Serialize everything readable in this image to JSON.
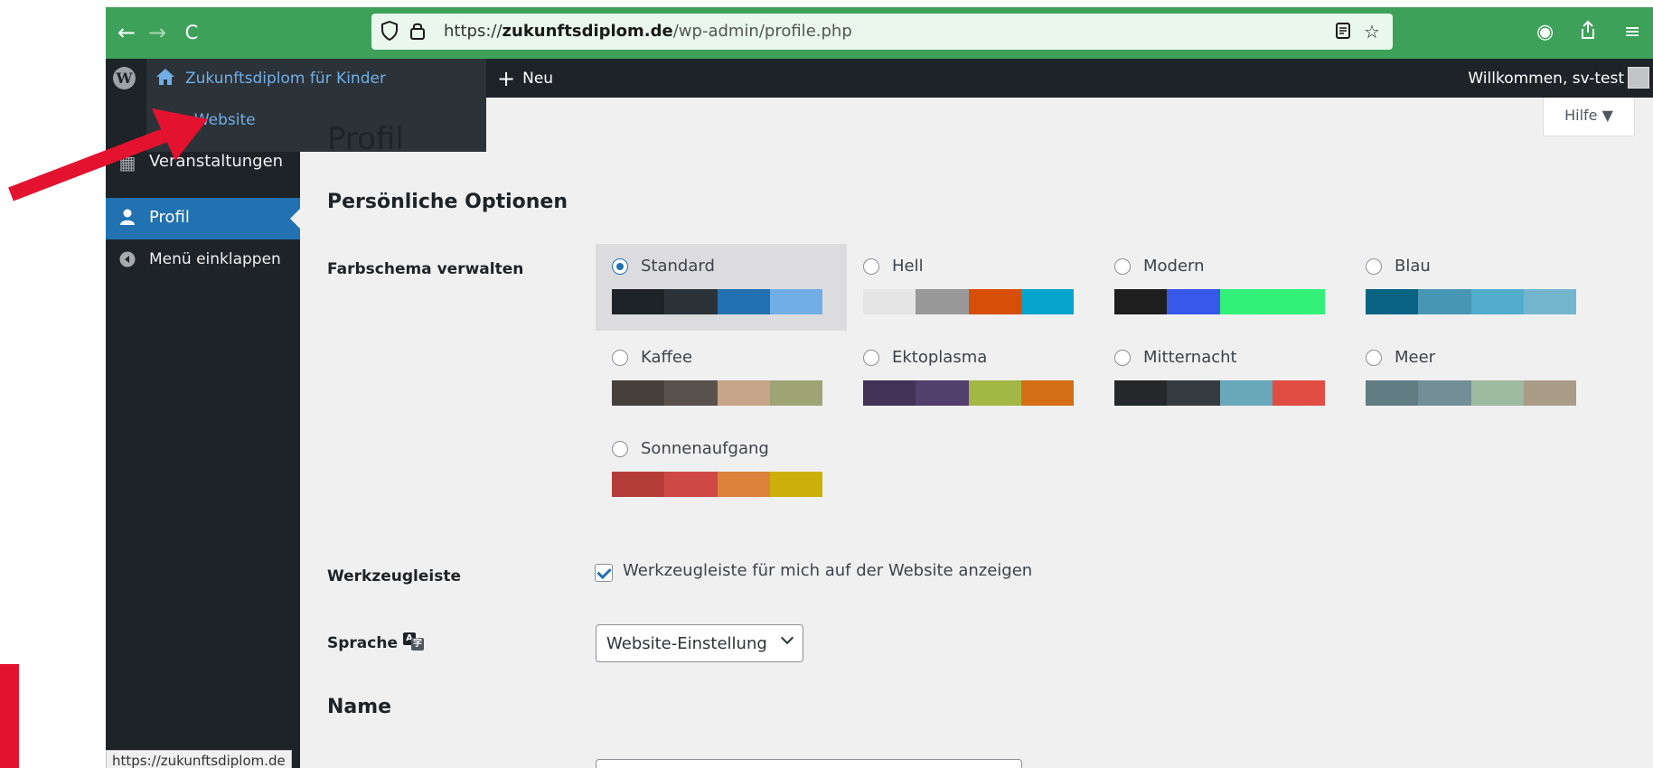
{
  "browser": {
    "back": "←",
    "forward": "→",
    "reload": "C",
    "url_prefix": "https://",
    "url_domain": "zukunftsdiplom.de",
    "url_path": "/wp-admin/profile.php",
    "accent": "#3ea15a"
  },
  "adminbar": {
    "site_name": "Zukunftsdiplom für Kinder",
    "new_label": "Neu",
    "welcome": "Willkommen, sv-test"
  },
  "dropdown": {
    "visit_site": "Zur Website"
  },
  "sidebar": {
    "items": [
      {
        "label": "Veranstaltungen",
        "icon": "calendar-icon"
      },
      {
        "label": "Profil",
        "icon": "user-icon",
        "active": true
      },
      {
        "label": "Menü einklappen",
        "icon": "collapse-icon"
      }
    ],
    "status_url": "https://zukunftsdiplom.de"
  },
  "help_label": "Hilfe ▼",
  "page": {
    "title": "Profil",
    "section_personal": "Persönliche Optionen",
    "section_name": "Name",
    "color_scheme_label": "Farbschema verwalten",
    "toolbar_label": "Werkzeugleiste",
    "toolbar_checkbox": "Werkzeugleiste für mich auf der Website anzeigen",
    "toolbar_checked": true,
    "language_label": "Sprache",
    "language_value": "Website-Einstellung"
  },
  "color_schemes": [
    {
      "name": "Standard",
      "selected": true,
      "colors": [
        "#1d2327",
        "#2c3338",
        "#2271b1",
        "#72aee6"
      ]
    },
    {
      "name": "Hell",
      "selected": false,
      "colors": [
        "#e5e5e5",
        "#999999",
        "#d64e07",
        "#04a4cc"
      ]
    },
    {
      "name": "Modern",
      "selected": false,
      "colors": [
        "#1e1e1e",
        "#3858e9",
        "#33f078",
        "#33f078"
      ]
    },
    {
      "name": "Blau",
      "selected": false,
      "colors": [
        "#096484",
        "#4796b3",
        "#52accc",
        "#74b6ce"
      ]
    },
    {
      "name": "Kaffee",
      "selected": false,
      "colors": [
        "#46403c",
        "#59524c",
        "#c7a589",
        "#9ea476"
      ]
    },
    {
      "name": "Ektoplasma",
      "selected": false,
      "colors": [
        "#413256",
        "#523f6d",
        "#a3b745",
        "#d46f15"
      ]
    },
    {
      "name": "Mitternacht",
      "selected": false,
      "colors": [
        "#25282b",
        "#363b3f",
        "#69a8bb",
        "#e14d43"
      ]
    },
    {
      "name": "Meer",
      "selected": false,
      "colors": [
        "#627c83",
        "#738e96",
        "#9ebaa0",
        "#aa9d88"
      ]
    },
    {
      "name": "Sonnenaufgang",
      "selected": false,
      "colors": [
        "#b43c38",
        "#cf4944",
        "#dd823b",
        "#ccaf0b"
      ]
    }
  ]
}
